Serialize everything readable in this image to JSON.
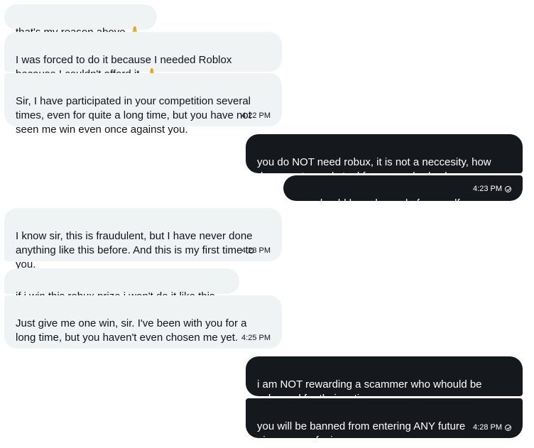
{
  "messages": [
    {
      "direction": "received",
      "text": "that's my reason above 🙏",
      "time": ""
    },
    {
      "direction": "received",
      "text": "I was forced to do it because I needed Roblox\nbecause I couldn't afford it. 🙏",
      "time": ""
    },
    {
      "direction": "received",
      "text": "Sir, I have participated in your competition several\ntimes, even for quite a long time, but you have not\nseen me win even once against you.",
      "time": "4:22 PM"
    },
    {
      "direction": "sent",
      "text": "you do NOT need robux, it is not a neccesity, how\ndare you try and steal from somebody else",
      "time": ""
    },
    {
      "direction": "sent",
      "text": "you should be ashamed of yourself",
      "time": "4:23 PM"
    },
    {
      "direction": "received",
      "text": "I know sir, this is fraudulent, but I have never done\nanything like this before. And this is my first time to\nyou.",
      "time": "4:23 PM"
    },
    {
      "direction": "received",
      "text": "if i win this robux prize i won't do it like this..",
      "time": ""
    },
    {
      "direction": "received",
      "text": "Just give me one win, sir. I've been with you for a\nlong time, but you haven't even chosen me yet.",
      "time": "4:25 PM"
    },
    {
      "direction": "sent",
      "text": "i am NOT rewarding a scammer who whould be\nashamed for their actions.",
      "time": ""
    },
    {
      "direction": "sent",
      "text": "you will be banned from entering ANY future\ngiveaways of mine",
      "time": "4:28 PM"
    }
  ],
  "colors": {
    "received_bg": "#eff3f4",
    "received_text": "#0f1419",
    "sent_bg": "#15181c",
    "sent_text": "#ffffff"
  },
  "icons": {
    "sent_status": "check-circle-icon"
  }
}
